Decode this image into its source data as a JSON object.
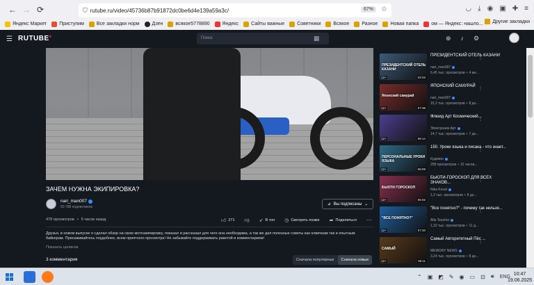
{
  "browser": {
    "url": "rutube.ru/video/45736b87b91872dc0be6d4e139a59a3c/",
    "zoom": "67%",
    "bookmarks": [
      "Яндекс Маркет",
      "Приступим",
      "Все закладки норм",
      "Дзен",
      "всякое5778890",
      "Яндекс",
      "Сайты важные",
      "Советники",
      "Всякое",
      "Разное",
      "Новая папка",
      "ом — Яндекс: нашло..."
    ],
    "other_bookmarks": "Другие закладки"
  },
  "header": {
    "logo": "RUTUBE",
    "search_placeholder": "Поиск"
  },
  "video": {
    "title": "ЗАЧЕМ НУЖНА ЭКИПИРОВКА?",
    "channel": "nari_man007",
    "subscribers": "50.788 подписчиков",
    "subscribed_label": "Вы подписаны",
    "views": "478 просмотров",
    "dot": "•",
    "age": "5 часов назад",
    "likes": "271",
    "in_top": "В топ",
    "watch_later": "Смотреть позже",
    "share": "Поделиться",
    "description": "Друзья, в новом выпуске я сделал обзор на свою мотоэкипировку, показал и рассказал для чего она необходима, а так же дал полезные советы как новичкам так и опытным байкерам. Присаживайтесь поудобнее, всем приятного просмотра! Не забывайте поддерживать ракетой и комментарием!",
    "show_all": "Показать целиком",
    "comments_count": "3 комментария",
    "sort_popular": "Сначала популярные",
    "sort_new": "Сначала новые"
  },
  "sidebar": {
    "items": [
      {
        "title": "ПРЕЗИДЕНТСКИЙ ОТЕЛЬ КАЗАНИ",
        "channel": "nari_man007",
        "views": "6,45 тыс. просмотров",
        "age": "4 ме...",
        "caption": "ПРЕЗИДЕНТСКИЙ ОТЕЛЬ КАЗАНИ",
        "duration": "03:03",
        "color": "#3c5a7a"
      },
      {
        "title": "ЯПОНСКИЙ САМУРАЙ",
        "channel": "nari_man007",
        "views": "15,2 тыс. просмотров",
        "age": "8 дн...",
        "caption": "Японский самурай",
        "duration": "07:38",
        "color": "#7a2b2b"
      },
      {
        "title": "Флюид Арт Космический...",
        "channel": "Электроник Арт",
        "views": "14,7 тыс. просмотров",
        "age": "7 дн...",
        "caption": "",
        "duration": "06:14",
        "color": "#4b3f8f"
      },
      {
        "title": "150. Уроки языка и писака - что знает...",
        "channel": "Кудикин",
        "views": "258 просмотров",
        "age": "15 часов...",
        "caption": "ПЕРСОНАЛЬНЫЕ УРОКИ ЯЗЫКА",
        "duration": "06:08",
        "color": "#2f6a8a"
      },
      {
        "title": "БЬЮТИ-ГОРОСКОП ДЛЯ ВСЕХ ЗНАКОВ...",
        "channel": "Nika Koval",
        "views": "1,2 тыс. просмотров",
        "age": "8 дн...",
        "caption": "БЬЮТИ ГОРОСКОП",
        "duration": "06:02",
        "color": "#8a2f4f"
      },
      {
        "title": "\"Все понятно?\" - почему так нельзя...",
        "channel": "Alla Teacher",
        "views": "1,32 тыс. просмотров",
        "age": "11 д...",
        "caption": "\"ВСЕ ПОНЯТНО?\"",
        "duration": "07:20",
        "color": "#1f5f9f"
      },
      {
        "title": "Самый Авторитетный Пёс ...",
        "channel": "MEMORY NEWS",
        "views": "3,24 тыс. просмотров",
        "age": "8 дн...",
        "caption": "САМЫЙ",
        "duration": "06:11",
        "color": "#5a3a1a"
      }
    ],
    "age_badge": "12+"
  },
  "taskbar": {
    "lang": "ENG",
    "time": "10:47",
    "date": "19.06.2025"
  }
}
